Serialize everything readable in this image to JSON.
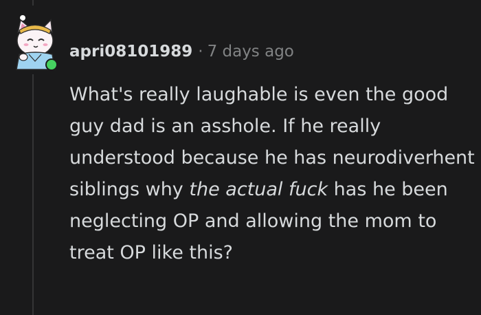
{
  "comment": {
    "username": "apri08101989",
    "separator": "·",
    "timestamp": "7 days ago",
    "body": {
      "part1": "What's really laughable is even the good guy dad is an asshole. If he really understood because he has neurodiverhent siblings why ",
      "emphasis": "the actual fuck",
      "part2": " has he been neglecting OP and allowing the mom to treat OP like this?"
    },
    "avatar": {
      "icon": "cat-avatar-icon",
      "online_status_color": "#46d160"
    }
  },
  "colors": {
    "background": "#1a1a1b",
    "text": "#d7dadc",
    "meta_text": "#818384",
    "thread_line": "#343536"
  }
}
